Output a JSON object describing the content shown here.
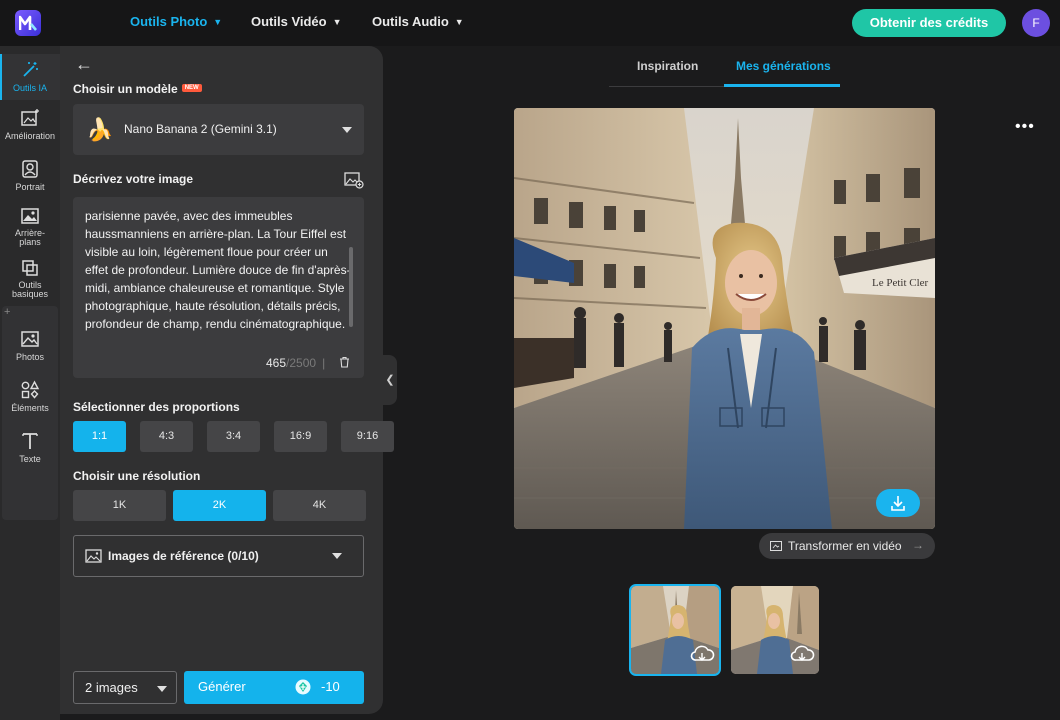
{
  "topbar": {
    "nav": [
      {
        "label": "Outils Photo",
        "active": true
      },
      {
        "label": "Outils Vidéo",
        "active": false
      },
      {
        "label": "Outils Audio",
        "active": false
      }
    ],
    "credits_label": "Obtenir des crédits",
    "avatar_letter": "F",
    "accent_color": "#1ab4ee",
    "credits_color": "#1fc6a6"
  },
  "rail": {
    "items": [
      {
        "label": "Outils IA",
        "icon": "magic-wand-icon",
        "active": true
      },
      {
        "label": "Amélioration",
        "icon": "image-enhance-icon"
      },
      {
        "label": "Portrait",
        "icon": "portrait-icon"
      },
      {
        "label": "Arrière-plans",
        "icon": "background-icon"
      },
      {
        "label": "Outils basiques",
        "icon": "crop-icon"
      },
      {
        "label": "Photos",
        "icon": "photo-icon"
      },
      {
        "label": "Éléments",
        "icon": "shapes-icon"
      },
      {
        "label": "Texte",
        "icon": "text-icon"
      }
    ],
    "add_symbol": "+"
  },
  "panel": {
    "model_label": "Choisir un modèle",
    "new_badge": "NEW",
    "model_name": "Nano Banana 2 (Gemini 3.1)",
    "model_emoji": "🍌",
    "prompt_label": "Décrivez votre image",
    "prompt_text": "parisienne pavée, avec des immeubles haussmanniens en arrière-plan. La Tour Eiffel est visible au loin, légèrement floue pour créer un effet de profondeur. Lumière douce de fin d'après-midi, ambiance chaleureuse et romantique. Style photographique, haute résolution, détails précis, profondeur de champ, rendu cinématographique.",
    "char_count": "465",
    "char_max": "/2500",
    "ratio_label": "Sélectionner des proportions",
    "ratios": [
      {
        "label": "1:1",
        "active": true
      },
      {
        "label": "4:3",
        "active": false
      },
      {
        "label": "3:4",
        "active": false
      },
      {
        "label": "16:9",
        "active": false
      },
      {
        "label": "9:16",
        "active": false
      }
    ],
    "resolution_label": "Choisir une résolution",
    "resolutions": [
      {
        "label": "1K",
        "active": false
      },
      {
        "label": "2K",
        "active": true
      },
      {
        "label": "4K",
        "active": false
      }
    ],
    "reference_label": "Images de référence (0/10)",
    "image_count": "2 images",
    "generate_label": "Générer",
    "generate_cost": "-10"
  },
  "main": {
    "tabs": [
      {
        "label": "Inspiration",
        "active": false
      },
      {
        "label": "Mes générations",
        "active": true
      }
    ],
    "transform_label": "Transformer en vidéo",
    "storefront_text": "Le Petit Cler"
  }
}
